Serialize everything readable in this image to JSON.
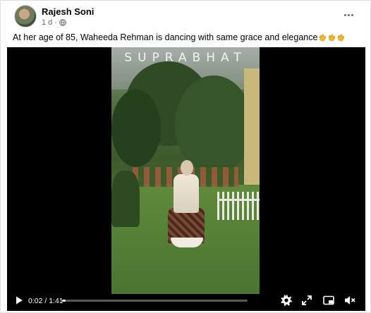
{
  "post": {
    "author": "Rajesh Soni",
    "timestamp": "1 d",
    "separator": "·",
    "audience_icon": "globe-icon",
    "caption": "At her age of 85, Waheeda Rehman is dancing with same grace and elegance",
    "caption_emojis": [
      "clapping-hands",
      "clapping-hands",
      "clapping-hands"
    ]
  },
  "video": {
    "watermark": "SUPRABHAT",
    "current_time": "0:02",
    "duration": "1:41",
    "time_label": "0:02 / 1:41",
    "progress": 0.02
  },
  "colors": {
    "text": "#050505",
    "secondary": "#65676b",
    "player_bg": "#000000",
    "emoji": "#f7b928"
  }
}
